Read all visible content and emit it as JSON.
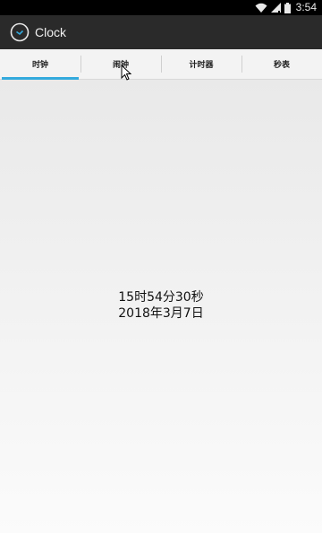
{
  "status_bar": {
    "time": "3:54",
    "icons": [
      "wifi-icon",
      "signal-icon",
      "battery-icon"
    ]
  },
  "app_bar": {
    "title": "Clock",
    "icon": "clock-icon"
  },
  "tabs": [
    {
      "label": "时钟",
      "active": true
    },
    {
      "label": "闹钟",
      "active": false
    },
    {
      "label": "计时器",
      "active": false
    },
    {
      "label": "秒表",
      "active": false
    }
  ],
  "clock": {
    "time": "15时54分30秒",
    "date": "2018年3月7日"
  },
  "colors": {
    "tab_indicator": "#33aadd",
    "action_bar": "#2a2a2a"
  }
}
